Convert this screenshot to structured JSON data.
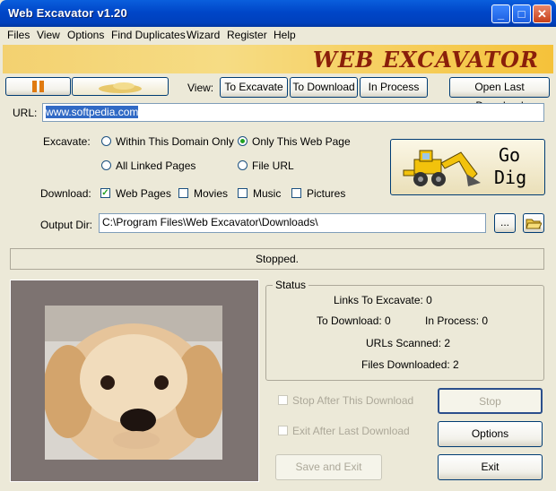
{
  "window": {
    "title": "Web Excavator v1.20"
  },
  "menu": [
    "Files",
    "View",
    "Options",
    "Find Duplicates",
    "Wizard",
    "Register",
    "Help"
  ],
  "banner": {
    "title": "WEB EXCAVATOR"
  },
  "toolbar": {
    "view_label": "View:",
    "to_excavate": "To Excavate",
    "to_download": "To Download",
    "in_process": "In Process",
    "open_last_download": "Open Last Download"
  },
  "url": {
    "label": "URL:",
    "value": "www.softpedia.com"
  },
  "excavate": {
    "label": "Excavate:",
    "options": [
      "Within This Domain Only",
      "Only This Web Page",
      "All Linked Pages",
      "File URL"
    ],
    "selected": "Only This Web Page"
  },
  "go_dig": {
    "line1": "Go",
    "line2": "Dig"
  },
  "download": {
    "label": "Download:",
    "web_pages": "Web Pages",
    "movies": "Movies",
    "music": "Music",
    "pictures": "Pictures"
  },
  "output_dir": {
    "label": "Output Dir:",
    "value": "C:\\Program Files\\Web Excavator\\Downloads\\",
    "browse": "..."
  },
  "status_bar": "Stopped.",
  "status": {
    "title": "Status",
    "links_to_excavate": "Links To Excavate: 0",
    "to_download": "To Download: 0",
    "in_process": "In Process: 0",
    "urls_scanned": "URLs Scanned: 2",
    "files_downloaded": "Files Downloaded: 2"
  },
  "controls": {
    "stop_after": "Stop After This Download",
    "exit_after": "Exit After Last Download",
    "stop": "Stop",
    "options": "Options",
    "save_exit": "Save and Exit",
    "exit": "Exit"
  },
  "colors": {
    "titlebar": "#0046C8",
    "accent_green": "#21a121",
    "banner_text": "#8a1f0a"
  }
}
